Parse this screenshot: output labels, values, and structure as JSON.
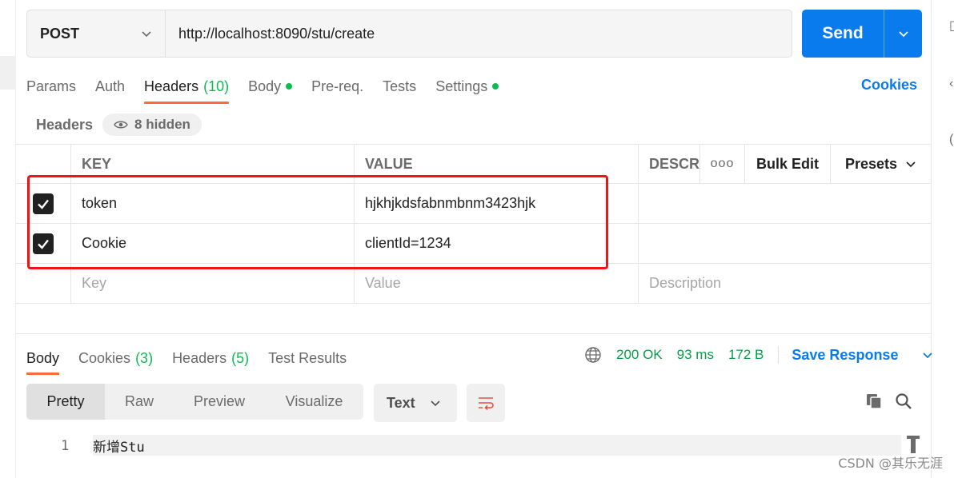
{
  "request": {
    "method": "POST",
    "url": "http://localhost:8090/stu/create",
    "send_label": "Send"
  },
  "request_tabs": [
    {
      "label": "Params"
    },
    {
      "label": "Auth"
    },
    {
      "label": "Headers",
      "count": "(10)",
      "active": true
    },
    {
      "label": "Body",
      "dot": true
    },
    {
      "label": "Pre-req."
    },
    {
      "label": "Tests"
    },
    {
      "label": "Settings",
      "dot": true
    }
  ],
  "cookies_link": "Cookies",
  "headers_section": {
    "title": "Headers",
    "hidden_label": "8 hidden"
  },
  "table": {
    "columns": {
      "key": "KEY",
      "value": "VALUE",
      "description": "DESCRI"
    },
    "more_label": "ooo",
    "bulk_edit": "Bulk Edit",
    "presets": "Presets",
    "rows": [
      {
        "checked": true,
        "key": "token",
        "value": "hjkhjkdsfabnmbnm3423hjk",
        "description": ""
      },
      {
        "checked": true,
        "key": "Cookie",
        "value": "clientId=1234",
        "description": ""
      }
    ],
    "placeholders": {
      "key": "Key",
      "value": "Value",
      "description": "Description"
    }
  },
  "response": {
    "tabs": [
      {
        "label": "Body",
        "active": true
      },
      {
        "label": "Cookies",
        "count": "(3)"
      },
      {
        "label": "Headers",
        "count": "(5)"
      },
      {
        "label": "Test Results"
      }
    ],
    "status": "200 OK",
    "time": "93 ms",
    "size": "172 B",
    "save_label": "Save Response",
    "view_modes": [
      "Pretty",
      "Raw",
      "Preview",
      "Visualize"
    ],
    "format": "Text",
    "lines": [
      {
        "no": "1",
        "text": "新增Stu"
      }
    ]
  },
  "watermark": "CSDN @其乐无涯",
  "colors": {
    "accent": "#097bed",
    "tab_underline": "#ff6c37",
    "success": "#0cbb52",
    "highlight_box": "#f01414"
  }
}
